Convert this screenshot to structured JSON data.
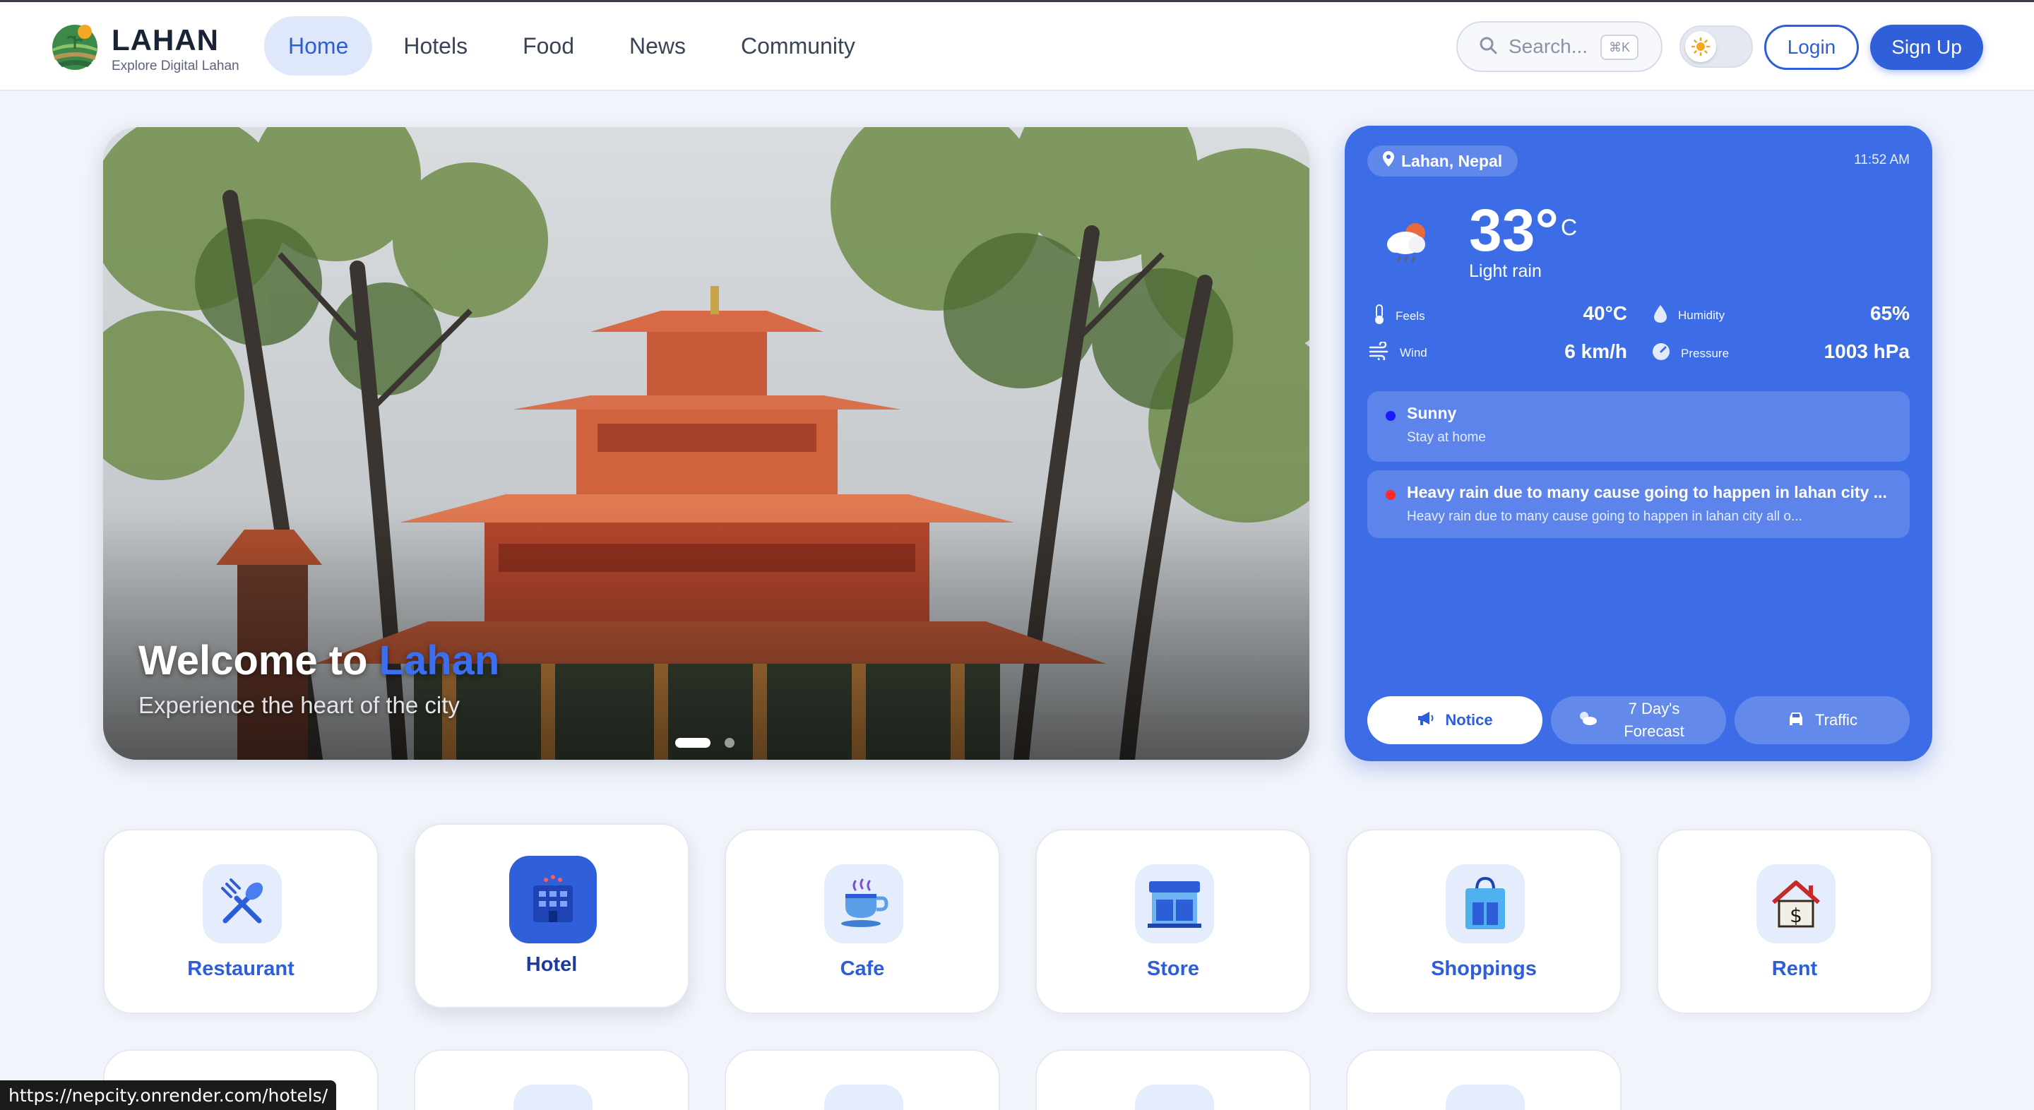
{
  "brand": {
    "title": "LAHAN",
    "subtitle": "Explore Digital Lahan"
  },
  "nav": [
    {
      "label": "Home",
      "active": true
    },
    {
      "label": "Hotels"
    },
    {
      "label": "Food"
    },
    {
      "label": "News"
    },
    {
      "label": "Community"
    }
  ],
  "search": {
    "placeholder": "Search...",
    "shortcut": "⌘K"
  },
  "auth": {
    "login": "Login",
    "signup": "Sign Up"
  },
  "hero": {
    "title_prefix": "Welcome to ",
    "title_highlight": "Lahan",
    "subtitle": "Experience the heart of the city",
    "slide_count": 2,
    "active_slide": 1
  },
  "weather": {
    "location": "Lahan, Nepal",
    "time": "11:52 AM",
    "temp": "33°",
    "unit": "C",
    "condition": "Light rain",
    "stats": {
      "feels_label": "Feels",
      "feels_value": "40°C",
      "humidity_label": "Humidity",
      "humidity_value": "65%",
      "wind_label": "Wind",
      "wind_value": "6 km/h",
      "pressure_label": "Pressure",
      "pressure_value": "1003 hPa"
    },
    "alerts": [
      {
        "title": "Sunny",
        "desc": "Stay at home",
        "color": "#1a1aff"
      },
      {
        "title": "Heavy rain due to many cause going to happen in lahan city ...",
        "desc": "Heavy rain due to many cause going to happen in lahan city all o...",
        "color": "#ff2a2a"
      }
    ],
    "tabs": [
      {
        "label": "Notice",
        "active": true
      },
      {
        "label": "7 Day's Forecast"
      },
      {
        "label": "Traffic"
      }
    ]
  },
  "categories": [
    {
      "label": "Restaurant",
      "icon": "fork-spoon-icon"
    },
    {
      "label": "Hotel",
      "icon": "hotel-building-icon"
    },
    {
      "label": "Cafe",
      "icon": "coffee-cup-icon"
    },
    {
      "label": "Store",
      "icon": "store-icon"
    },
    {
      "label": "Shoppings",
      "icon": "shopping-bag-icon"
    },
    {
      "label": "Rent",
      "icon": "house-dollar-icon"
    }
  ],
  "status_url": "https://nepcity.onrender.com/hotels/",
  "colors": {
    "primary": "#2f5fd9",
    "weather_bg": "#3d6de6",
    "page_bg": "#f2f4fb"
  }
}
